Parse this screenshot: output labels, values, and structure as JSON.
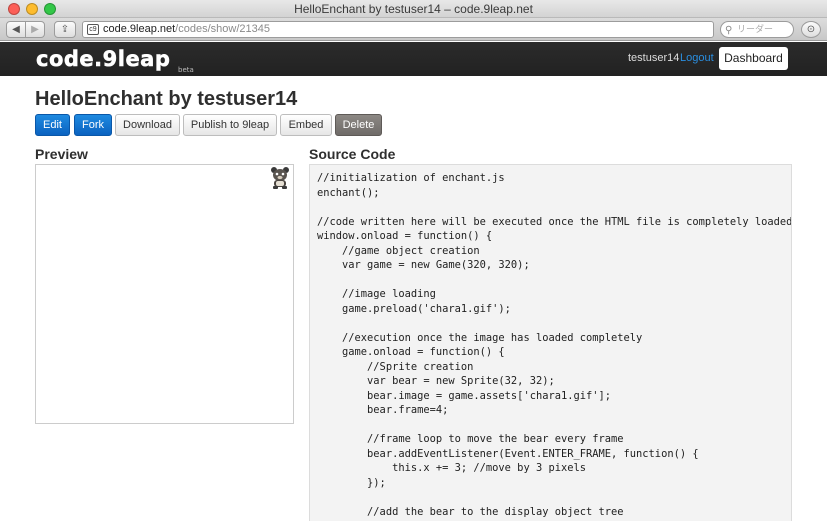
{
  "window": {
    "title": "HelloEnchant by testuser14 – code.9leap.net"
  },
  "browser": {
    "back_icon": "◀",
    "forward_icon": "▶",
    "share_icon": "⇪",
    "url_host": "code.9leap.net",
    "url_path": "/codes/show/21345",
    "search_placeholder": "リーダー",
    "download_icon": "⊙"
  },
  "site": {
    "logo": "code.9leap",
    "logo_badge": "beta",
    "user": "testuser14",
    "logout_label": "Logout",
    "dashboard_label": "Dashboard"
  },
  "page": {
    "title": "HelloEnchant by testuser14",
    "buttons": {
      "edit": "Edit",
      "fork": "Fork",
      "download": "Download",
      "publish": "Publish to 9leap",
      "embed": "Embed",
      "delete": "Delete"
    },
    "preview_heading": "Preview",
    "source_heading": "Source Code"
  },
  "code": {
    "lines": [
      "//initialization of enchant.js",
      "enchant();",
      "",
      "//code written here will be executed once the HTML file is completely loaded",
      "window.onload = function() {",
      "    //game object creation",
      "    var game = new Game(320, 320);",
      "",
      "    //image loading",
      "    game.preload('chara1.gif');",
      "",
      "    //execution once the image has loaded completely",
      "    game.onload = function() {",
      "        //Sprite creation",
      "        var bear = new Sprite(32, 32);",
      "        bear.image = game.assets['chara1.gif'];",
      "        bear.frame=4;",
      "",
      "        //frame loop to move the bear every frame",
      "        bear.addEventListener(Event.ENTER_FRAME, function() {",
      "            this.x += 3; //move by 3 pixels",
      "        });",
      "",
      "        //add the bear to the display object tree"
    ]
  },
  "colors": {
    "primary_button": "#0b62c0",
    "delete_button": "#6f6b68",
    "nav_background": "#222222",
    "logout_link": "#2a8ee0"
  }
}
